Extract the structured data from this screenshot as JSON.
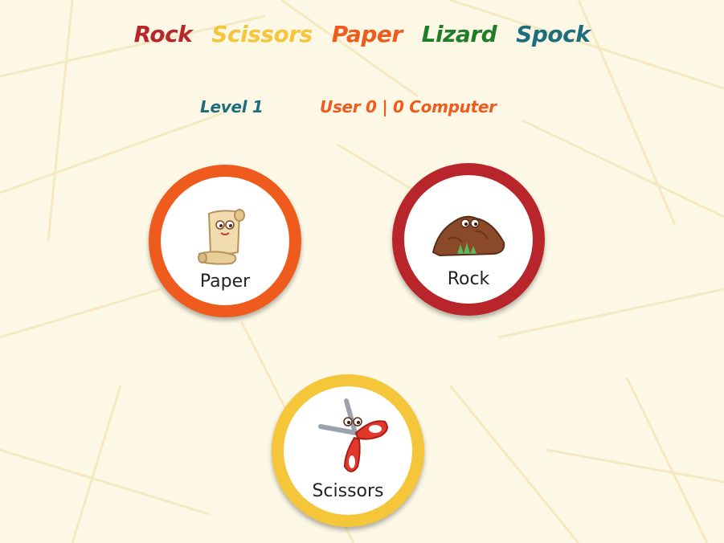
{
  "title_words": [
    {
      "text": "Rock",
      "color": "#b8262b"
    },
    {
      "text": "Scissors",
      "color": "#f5c53a"
    },
    {
      "text": "Paper",
      "color": "#ee5b1c"
    },
    {
      "text": "Lizard",
      "color": "#1f7d2a"
    },
    {
      "text": "Spock",
      "color": "#1d6e7c"
    }
  ],
  "status": {
    "level": "Level 1",
    "score": "User 0 | 0 Computer",
    "level_color": "#1d6e7c",
    "score_color": "#ee5b1c"
  },
  "choices": [
    {
      "label": "Paper",
      "ring_color": "#ee5b1c",
      "icon": "paper-scroll-icon"
    },
    {
      "label": "Rock",
      "ring_color": "#b8262b",
      "icon": "rock-icon"
    },
    {
      "label": "Scissors",
      "ring_color": "#f5c53a",
      "icon": "scissors-icon"
    }
  ]
}
